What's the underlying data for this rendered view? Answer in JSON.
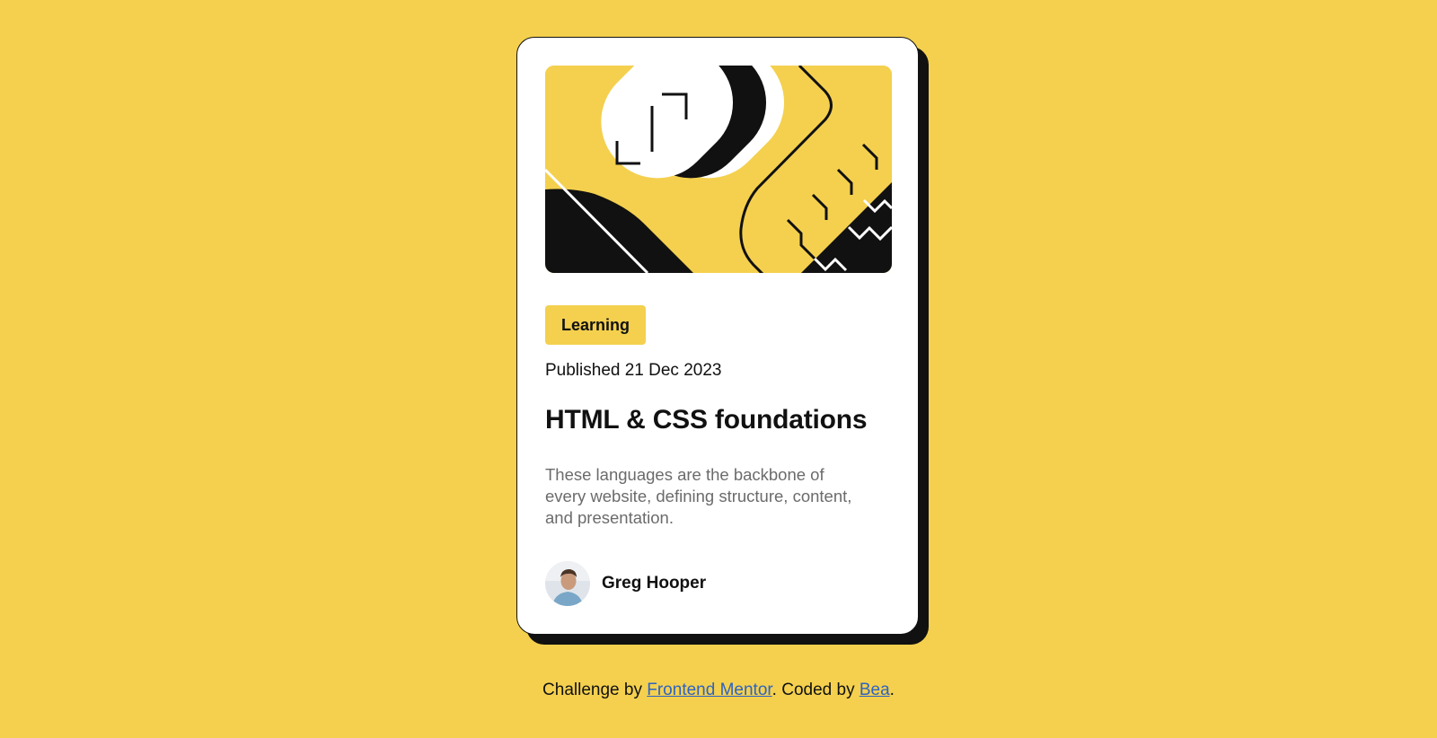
{
  "card": {
    "category": "Learning",
    "published": "Published 21 Dec 2023",
    "title": "HTML & CSS foundations",
    "description": "These languages are the backbone of every website, defining structure, content, and presentation.",
    "author": {
      "name": "Greg Hooper",
      "avatar_icon": "avatar-photo"
    },
    "hero_icon": "code-illustration"
  },
  "attribution": {
    "prefix": "Challenge by ",
    "link1": "Frontend Mentor",
    "middle": ". Coded by ",
    "link2": "Bea",
    "suffix": "."
  },
  "colors": {
    "background": "#F4D04E",
    "card": "#FFFFFF",
    "text": "#111111",
    "muted": "#6B6B6B",
    "link": "#2E63C2"
  }
}
